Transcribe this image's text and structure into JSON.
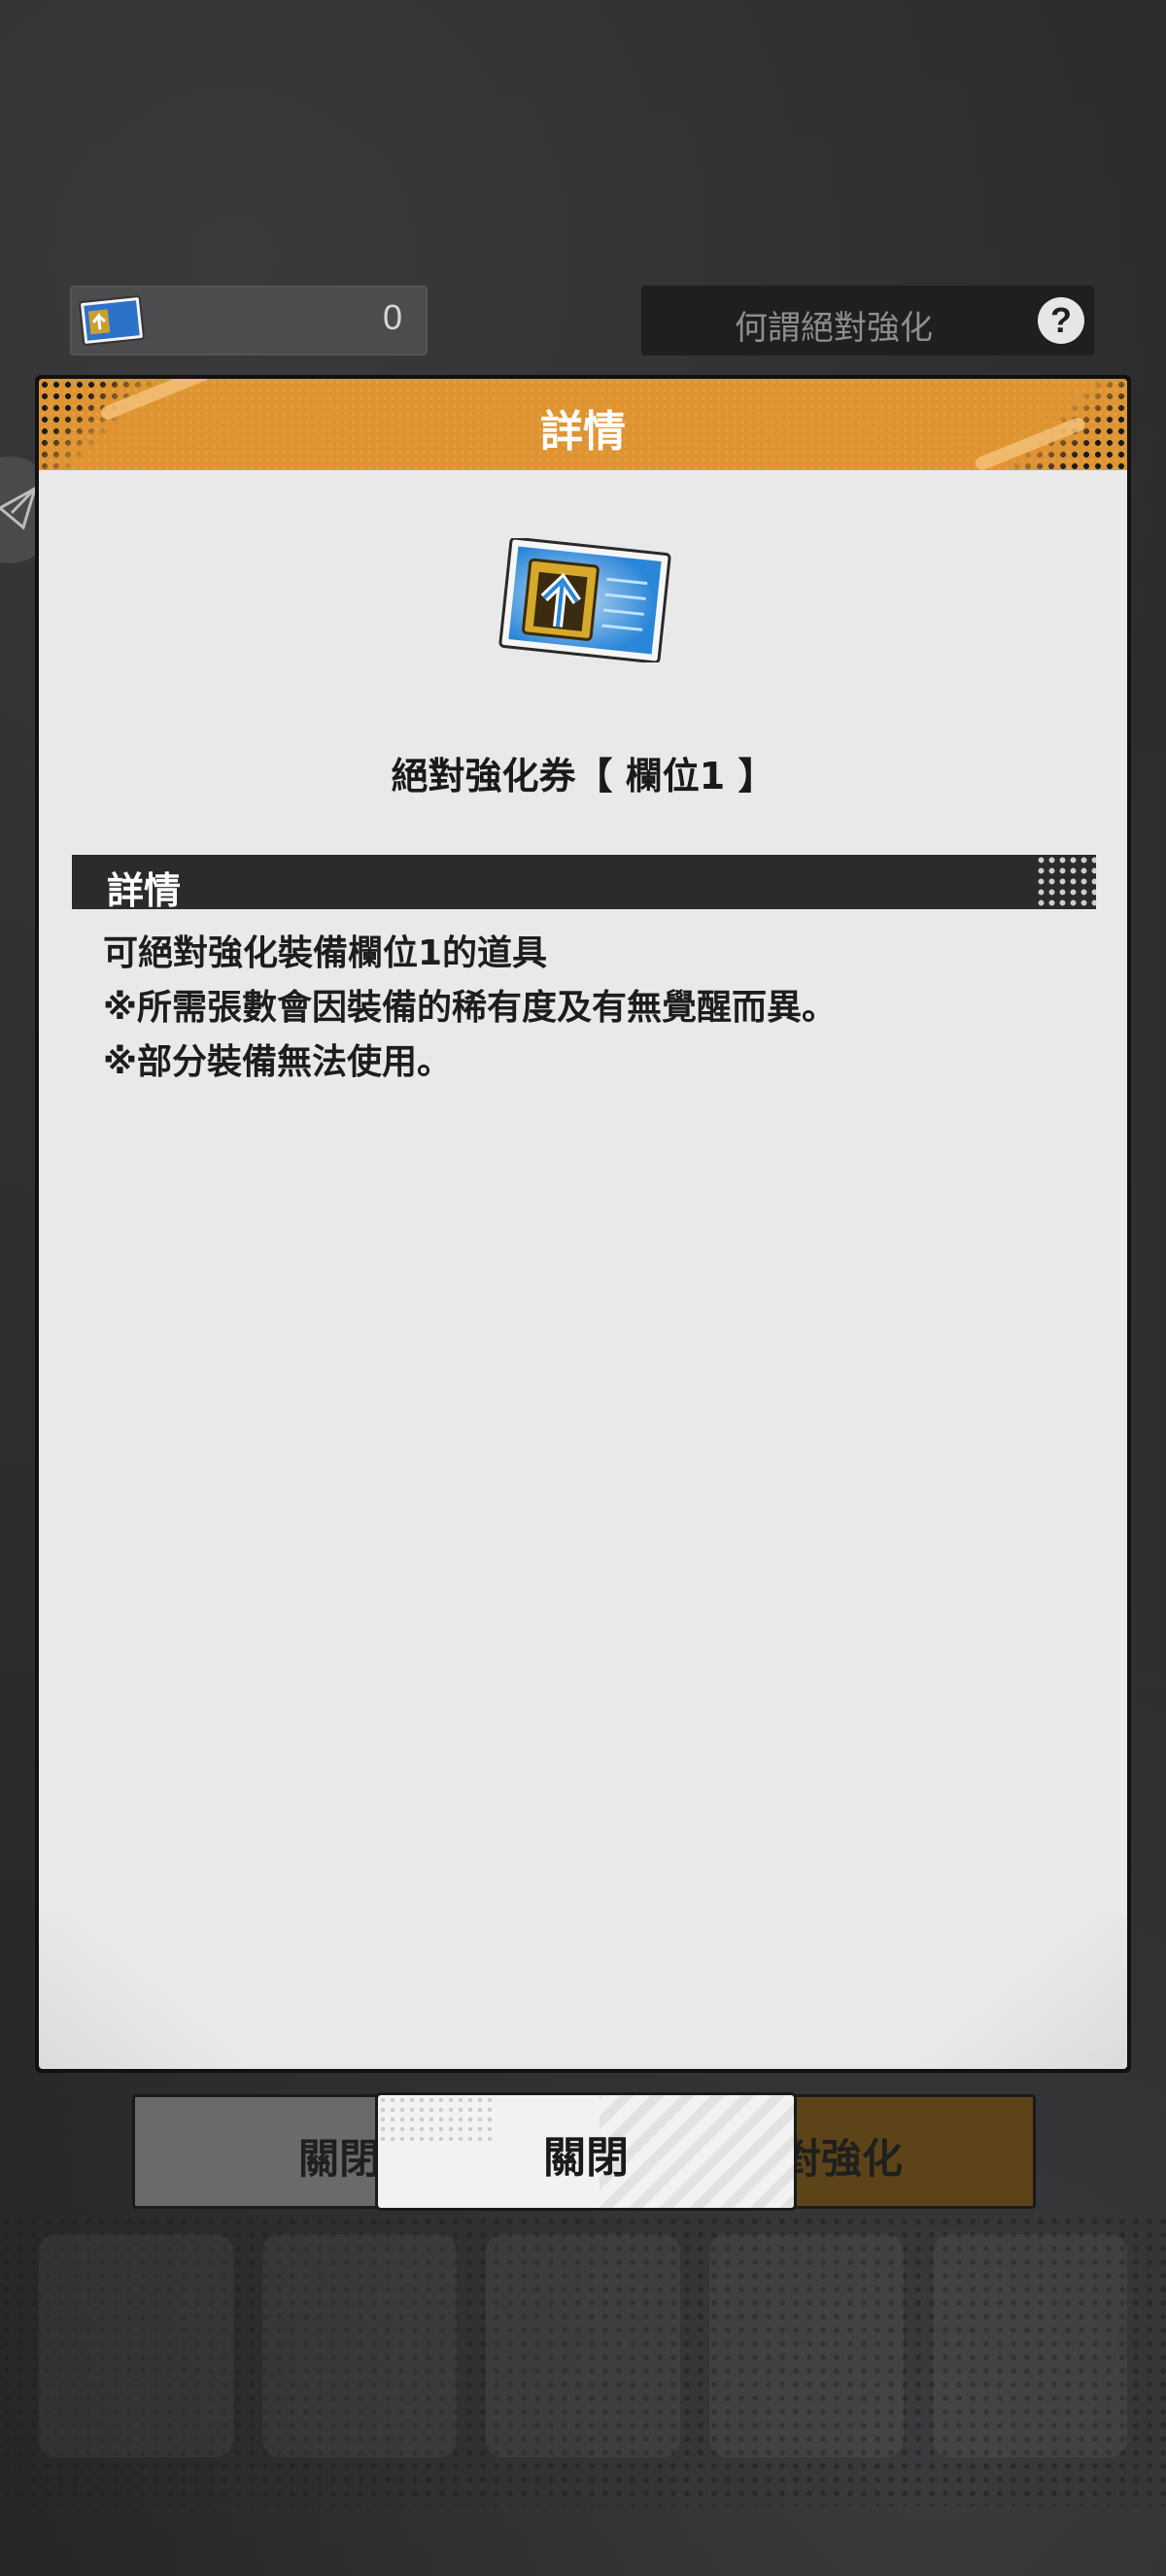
{
  "top_bar": {
    "ticket_count": "0",
    "help_label": "何謂絕對強化",
    "help_icon": "question-mark-icon"
  },
  "dialog": {
    "title": "詳情",
    "item_name": "絕對強化券【 欄位1 】",
    "item_icon": "absolute-enhance-ticket-icon",
    "section_label": "詳情",
    "description": [
      "可絕對強化裝備欄位1的道具",
      "※所需張數會因裝備的稀有度及有無覺醒而異。",
      "※部分裝備無法使用。"
    ]
  },
  "buttons": {
    "close_label": "關閉",
    "back_left_label": "關閉",
    "back_right_label": "對強化"
  },
  "colors": {
    "header_orange": "#df9432",
    "panel_bg": "#e9e9e9",
    "section_bar": "#2b2b2c"
  }
}
